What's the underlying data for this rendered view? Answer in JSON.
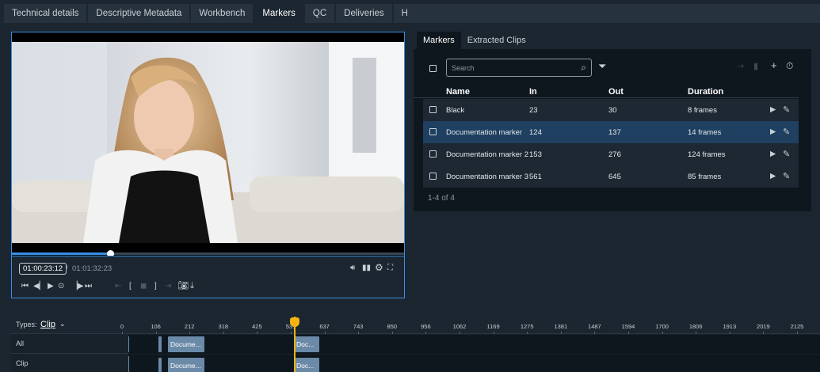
{
  "top_tabs": [
    {
      "label": "Technical details"
    },
    {
      "label": "Descriptive Metadata"
    },
    {
      "label": "Workbench"
    },
    {
      "label": "Markers",
      "active": true
    },
    {
      "label": "QC"
    },
    {
      "label": "Deliveries"
    },
    {
      "label": "History"
    }
  ],
  "player": {
    "current_timecode": "01:00:23:12",
    "separator": "/",
    "total_timecode": "01:01:32:23",
    "progress": 0.25,
    "accent_color": "#3a8ee6"
  },
  "right_tabs": [
    {
      "label": "Markers",
      "active": true
    },
    {
      "label": "Extracted Clips"
    }
  ],
  "markers": {
    "search_placeholder": "Search",
    "columns": [
      "Name",
      "In",
      "Out",
      "Duration"
    ],
    "rows": [
      {
        "name": "Black",
        "in": "23",
        "out": "30",
        "duration": "8 frames"
      },
      {
        "name": "Documentation marker",
        "in": "124",
        "out": "137",
        "duration": "14 frames",
        "selected": true
      },
      {
        "name": "Documentation marker 2",
        "in": "153",
        "out": "276",
        "duration": "124 frames"
      },
      {
        "name": "Documentation marker 3",
        "in": "561",
        "out": "645",
        "duration": "85 frames"
      }
    ],
    "pager": "1-4 of 4"
  },
  "timeline": {
    "types_label": "Types:",
    "types_value": "Clip",
    "ticks": [
      "0",
      "106",
      "212",
      "318",
      "425",
      "531",
      "637",
      "743",
      "850",
      "956",
      "1062",
      "1169",
      "1275",
      "1381",
      "1487",
      "1594",
      "1700",
      "1806",
      "1913",
      "2019",
      "2125"
    ],
    "lanes": [
      {
        "label": "All",
        "clips": [
          {
            "label": "Docume..."
          },
          {
            "label": "Doc..."
          }
        ]
      },
      {
        "label": "Clip",
        "clips": [
          {
            "label": "Docume..."
          },
          {
            "label": "Doc..."
          }
        ]
      }
    ],
    "playhead_color": "#f5b312"
  }
}
